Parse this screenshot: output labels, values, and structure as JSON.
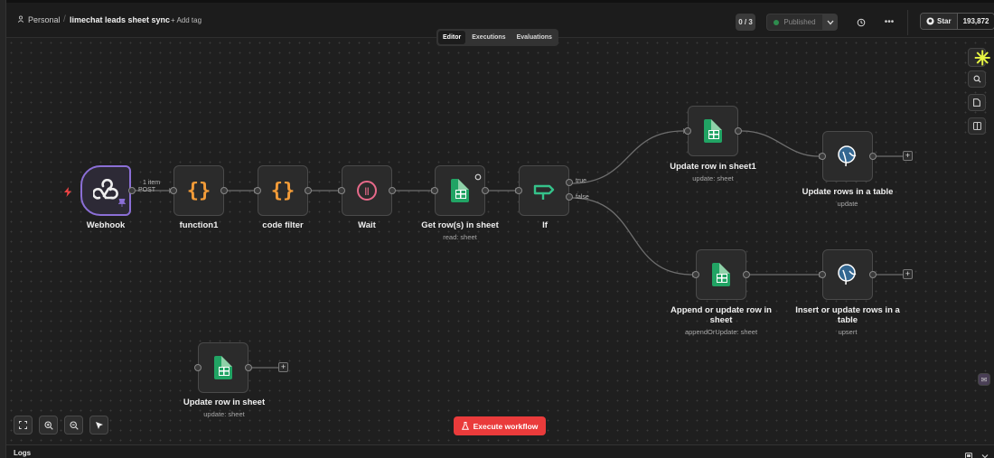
{
  "header": {
    "workspace": "Personal",
    "separator": "/",
    "workflow_title": "limechat leads sheet sync",
    "add_tag": "+ Add tag",
    "version_count": "0 / 3",
    "publish_status": "Published",
    "github_star_label": "Star",
    "github_star_count": "193,872"
  },
  "tabs": [
    "Editor",
    "Executions",
    "Evaluations"
  ],
  "active_tab": "Editor",
  "nodes": {
    "webhook": {
      "label": "Webhook"
    },
    "function1": {
      "label": "function1"
    },
    "code_filter": {
      "label": "code filter"
    },
    "wait": {
      "label": "Wait"
    },
    "get_rows": {
      "label": "Get row(s) in sheet",
      "subtitle": "read: sheet"
    },
    "if": {
      "label": "If"
    },
    "update_row1": {
      "label": "Update row in sheet1",
      "subtitle": "update: sheet"
    },
    "update_rows_table": {
      "label": "Update rows in a table",
      "subtitle": "update"
    },
    "append_update": {
      "label": "Append or update row in sheet",
      "subtitle": "appendOrUpdate: sheet"
    },
    "insert_update_table": {
      "label": "Insert or update rows in a table",
      "subtitle": "upsert"
    },
    "update_row": {
      "label": "Update row in sheet",
      "subtitle": "update: sheet"
    }
  },
  "edges": {
    "webhook_items": "1 item",
    "webhook_method": "POST",
    "if_true": "true",
    "if_false": "false"
  },
  "execute_button": "Execute workflow",
  "logs_label": "Logs",
  "colors": {
    "accent_red": "#ea3b3b",
    "webhook_border": "#8b6fd6",
    "sheets_green": "#21a464",
    "code_orange": "#f29b38",
    "wait_pink": "#e76a8a",
    "if_green": "#35c28a",
    "postgres_blue": "#336791"
  },
  "icons": [
    "user-icon",
    "history-icon",
    "more-icon",
    "github-icon",
    "sparkle-icon",
    "search-icon",
    "note-icon",
    "panel-icon",
    "fit-view-icon",
    "zoom-in-icon",
    "zoom-out-icon",
    "cursor-icon",
    "flask-icon",
    "trigger-bolt-icon",
    "pin-icon",
    "refresh-icon"
  ]
}
